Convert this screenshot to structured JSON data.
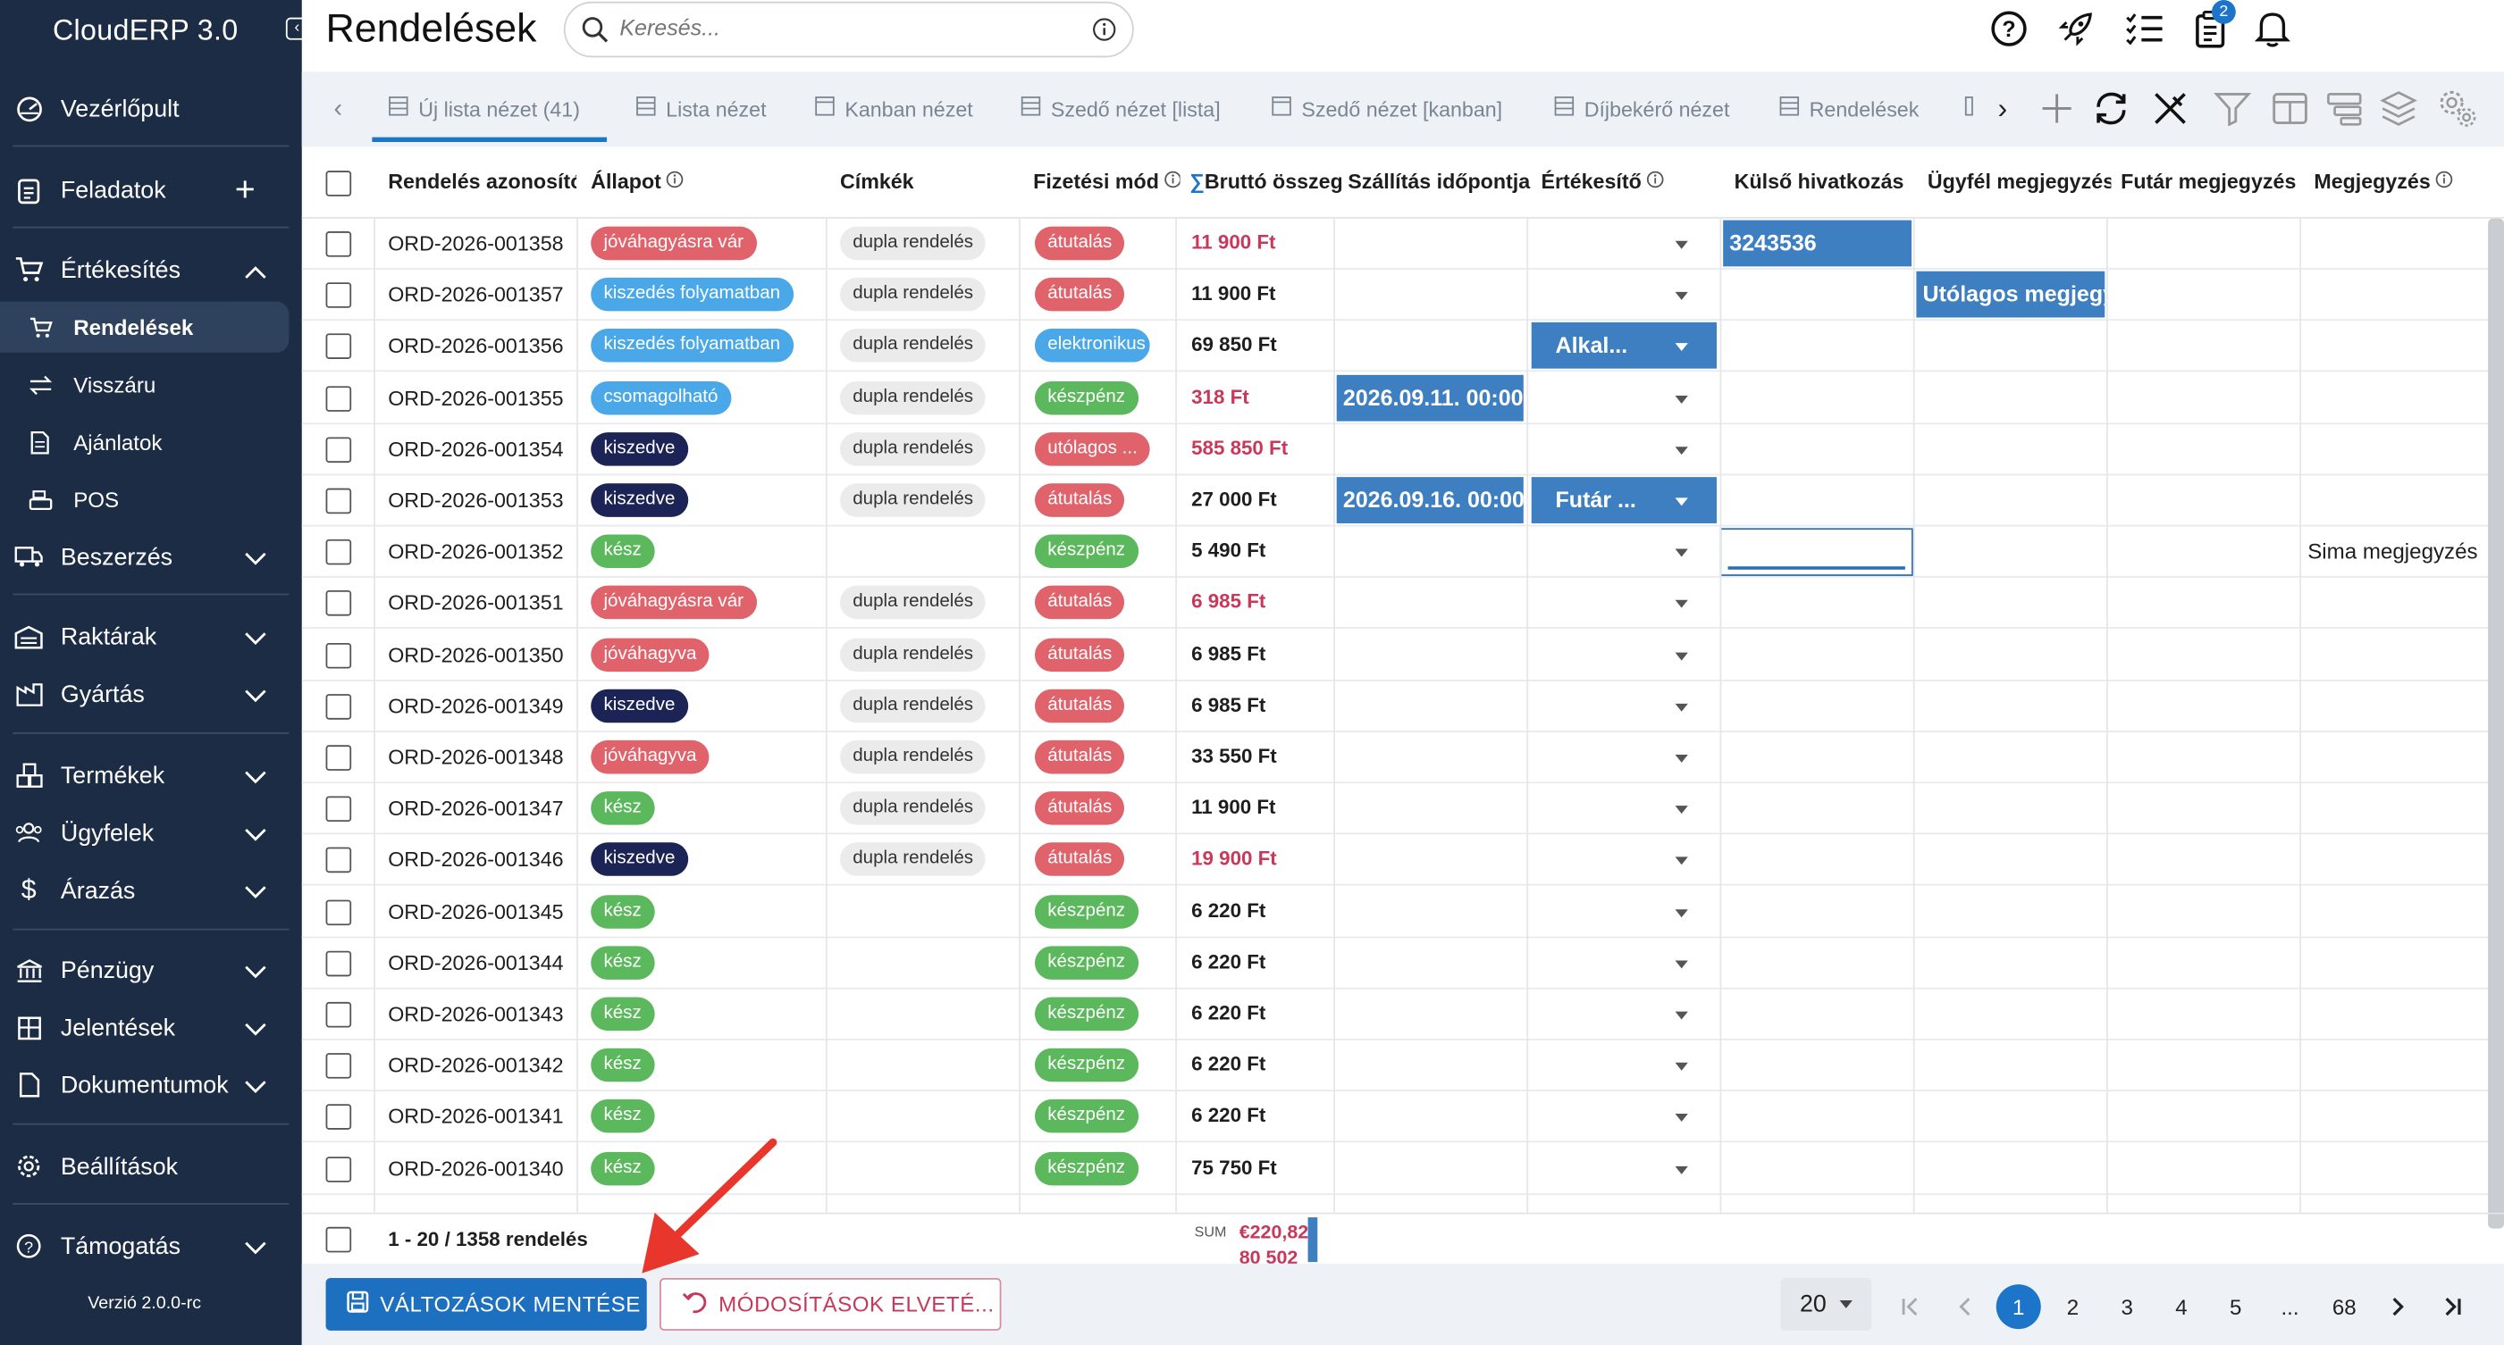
{
  "app": {
    "name": "CloudERP 3.0",
    "version": "Verzió 2.0.0-rc"
  },
  "sidebar": {
    "items": [
      {
        "label": "Vezérlőpult",
        "icon": "dashboard-icon"
      },
      {
        "label": "Feladatok",
        "icon": "clipboard-icon"
      },
      {
        "label": "Értékesítés",
        "icon": "cart-icon",
        "expanded": true
      },
      {
        "label": "Rendelések",
        "icon": "cart-icon",
        "active": true
      },
      {
        "label": "Visszáru",
        "icon": "arrows-icon"
      },
      {
        "label": "Ajánlatok",
        "icon": "document-icon"
      },
      {
        "label": "POS",
        "icon": "register-icon"
      },
      {
        "label": "Beszerzés",
        "icon": "truck-icon"
      },
      {
        "label": "Raktárak",
        "icon": "warehouse-icon"
      },
      {
        "label": "Gyártás",
        "icon": "factory-icon"
      },
      {
        "label": "Termékek",
        "icon": "boxes-icon"
      },
      {
        "label": "Ügyfelek",
        "icon": "users-icon"
      },
      {
        "label": "Árazás",
        "icon": "dollar-icon"
      },
      {
        "label": "Pénzügy",
        "icon": "bank-icon"
      },
      {
        "label": "Jelentések",
        "icon": "table-icon"
      },
      {
        "label": "Dokumentumok",
        "icon": "file-icon"
      },
      {
        "label": "Beállítások",
        "icon": "gear-icon"
      },
      {
        "label": "Támogatás",
        "icon": "help-icon"
      }
    ]
  },
  "header": {
    "title": "Rendelések",
    "search_placeholder": "Keresés...",
    "notification_count": "2"
  },
  "tabs": [
    {
      "label": "Új lista nézet (41)",
      "active": true
    },
    {
      "label": "Lista nézet"
    },
    {
      "label": "Kanban nézet"
    },
    {
      "label": "Szedő nézet [lista]"
    },
    {
      "label": "Szedő nézet [kanban]"
    },
    {
      "label": "Díjbekérő nézet"
    },
    {
      "label": "Rendelések"
    }
  ],
  "columns": [
    "Rendelés azonosító",
    "Állapot",
    "Címkék",
    "Fizetési mód",
    "Bruttó összeg",
    "Szállítás időpontja",
    "Értékesítő",
    "Külső hivatkozás",
    "Ügyfél megjegyzés",
    "Futár megjegyzés",
    "Megjegyzés"
  ],
  "rows": [
    {
      "id": "ORD-2026-001358",
      "status": "jóváhagyásra vár",
      "tag": "dupla rendelés",
      "pay": "átutalás",
      "amount": "11 900 Ft",
      "red": true,
      "ext": "3243536"
    },
    {
      "id": "ORD-2026-001357",
      "status": "kiszedés folyamatban",
      "tag": "dupla rendelés",
      "pay": "átutalás",
      "amount": "11 900 Ft",
      "cust": "Utólagos megjegyzés"
    },
    {
      "id": "ORD-2026-001356",
      "status": "kiszedés folyamatban",
      "tag": "dupla rendelés",
      "pay": "elektronikus",
      "amount": "69 850 Ft",
      "seller": "Alkal..."
    },
    {
      "id": "ORD-2026-001355",
      "status": "csomagolható",
      "tag": "dupla rendelés",
      "pay": "készpénz",
      "amount": "318 Ft",
      "red": true,
      "ship": "2026.09.11. 00:00"
    },
    {
      "id": "ORD-2026-001354",
      "status": "kiszedve",
      "tag": "dupla rendelés",
      "pay": "utólagos ...",
      "amount": "585 850 Ft",
      "red": true
    },
    {
      "id": "ORD-2026-001353",
      "status": "kiszedve",
      "tag": "dupla rendelés",
      "pay": "átutalás",
      "amount": "27 000 Ft",
      "ship": "2026.09.16. 00:00",
      "seller": "Futár ..."
    },
    {
      "id": "ORD-2026-001352",
      "status": "kész",
      "tag": "",
      "pay": "készpénz",
      "amount": "5 490 Ft",
      "editing": true,
      "note": "Sima megjegyzés"
    },
    {
      "id": "ORD-2026-001351",
      "status": "jóváhagyásra vár",
      "tag": "dupla rendelés",
      "pay": "átutalás",
      "amount": "6 985 Ft",
      "red": true
    },
    {
      "id": "ORD-2026-001350",
      "status": "jóváhagyva",
      "tag": "dupla rendelés",
      "pay": "átutalás",
      "amount": "6 985 Ft"
    },
    {
      "id": "ORD-2026-001349",
      "status": "kiszedve",
      "tag": "dupla rendelés",
      "pay": "átutalás",
      "amount": "6 985 Ft"
    },
    {
      "id": "ORD-2026-001348",
      "status": "jóváhagyva",
      "tag": "dupla rendelés",
      "pay": "átutalás",
      "amount": "33 550 Ft"
    },
    {
      "id": "ORD-2026-001347",
      "status": "kész",
      "tag": "dupla rendelés",
      "pay": "átutalás",
      "amount": "11 900 Ft"
    },
    {
      "id": "ORD-2026-001346",
      "status": "kiszedve",
      "tag": "dupla rendelés",
      "pay": "átutalás",
      "amount": "19 900 Ft",
      "red": true
    },
    {
      "id": "ORD-2026-001345",
      "status": "kész",
      "tag": "",
      "pay": "készpénz",
      "amount": "6 220 Ft"
    },
    {
      "id": "ORD-2026-001344",
      "status": "kész",
      "tag": "",
      "pay": "készpénz",
      "amount": "6 220 Ft"
    },
    {
      "id": "ORD-2026-001343",
      "status": "kész",
      "tag": "",
      "pay": "készpénz",
      "amount": "6 220 Ft"
    },
    {
      "id": "ORD-2026-001342",
      "status": "kész",
      "tag": "",
      "pay": "készpénz",
      "amount": "6 220 Ft"
    },
    {
      "id": "ORD-2026-001341",
      "status": "kész",
      "tag": "",
      "pay": "készpénz",
      "amount": "6 220 Ft"
    },
    {
      "id": "ORD-2026-001340",
      "status": "kész",
      "tag": "",
      "pay": "készpénz",
      "amount": "75 750 Ft"
    }
  ],
  "status_colors": {
    "jóváhagyásra vár": "#e0626b",
    "kiszedés folyamatban": "#4aa8e8",
    "csomagolható": "#4aa8e8",
    "kiszedve": "#1b2454",
    "kész": "#5cb85c",
    "jóváhagyva": "#e0626b"
  },
  "pay_colors": {
    "átutalás": "#e0626b",
    "elektronikus": "#4aa8e8",
    "készpénz": "#5cb85c",
    "utólagos ...": "#e0626b"
  },
  "footer": {
    "summary": "1 - 20 / 1358 rendelés",
    "sum_label": "SUM",
    "sum_value": "€220,82",
    "sum_value2": "80 502",
    "save_label": "VÁLTOZÁSOK MENTÉSE",
    "discard_label": "MÓDOSÍTÁSOK ELVETÉ...",
    "page_size": "20",
    "pages": [
      "1",
      "2",
      "3",
      "4",
      "5",
      "...",
      "68"
    ],
    "current_page": "1"
  },
  "annotation": {
    "arrow_color": "#e8362c"
  }
}
